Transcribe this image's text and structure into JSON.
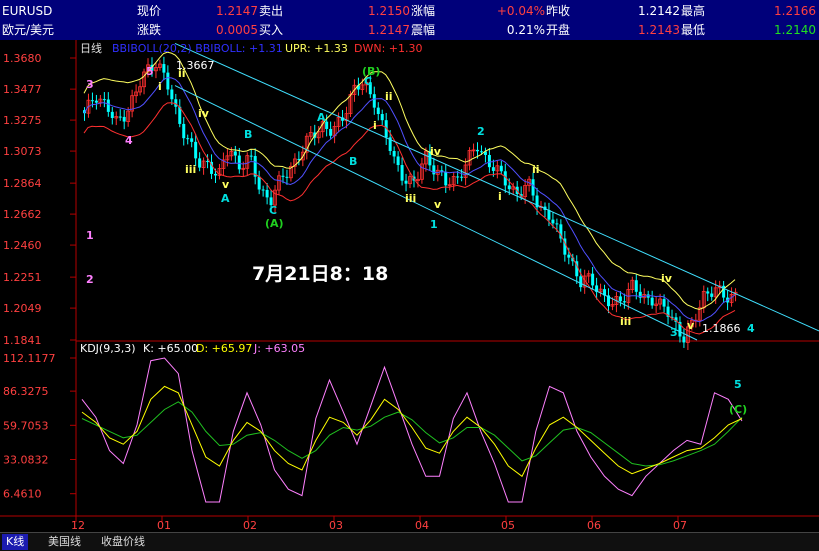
{
  "quote": {
    "symbol": "EURUSD",
    "name": "欧元/美元",
    "labels": {
      "last": "现价",
      "sell": "卖出",
      "change_pct": "涨幅",
      "prev_close": "昨收",
      "high": "最高",
      "change": "涨跌",
      "buy": "买入",
      "amplitude": "震幅",
      "open": "开盘",
      "low": "最低"
    },
    "values": {
      "last": "1.2147",
      "sell": "1.2150",
      "change_pct": "+0.04%",
      "prev_close": "1.2142",
      "high": "1.2166",
      "change": "0.0005",
      "buy": "1.2147",
      "amplitude": "0.21%",
      "open": "1.2143",
      "low": "1.2140"
    }
  },
  "colors": {
    "up": "#ff3030",
    "down": "#00ffff",
    "boll_mid": "#ffffff",
    "boll_up": "#ffff60",
    "boll_dn": "#ff3030",
    "k": "#ffffff",
    "d": "#ffff00",
    "j": "#ff80ff",
    "channel": "#40e0ff"
  },
  "main_panel": {
    "period": "日线",
    "indicator": "BBIBOLL(20,2)",
    "bbiboll_label": "BBIBOLL: +1.31",
    "upr_label": "UPR: +1.33",
    "dwn_label": "DWN: +1.30",
    "y_ticks": [
      "1.3680",
      "1.3477",
      "1.3275",
      "1.3073",
      "1.2864",
      "1.2662",
      "1.2460",
      "1.2251",
      "1.2049",
      "1.1841"
    ],
    "high_label": "1.3667",
    "low_label": "1.1866",
    "annotation": "7月21日8：18"
  },
  "kdj_panel": {
    "title": "KDJ(9,3,3)",
    "k_label": "K: +65.00",
    "d_label": "D: +65.97",
    "j_label": "J: +63.05",
    "y_ticks": [
      "112.1177",
      "86.3275",
      "59.7053",
      "33.0832",
      "6.4610"
    ]
  },
  "x_axis": {
    "ticks": [
      "12",
      "01",
      "02",
      "03",
      "04",
      "05",
      "06",
      "07"
    ]
  },
  "tabs": [
    "K线",
    "美国线",
    "收盘价线"
  ],
  "chart_data": {
    "type": "line",
    "x_ticks": [
      "12",
      "01",
      "02",
      "03",
      "04",
      "05",
      "06",
      "07"
    ],
    "price": {
      "ylim": [
        1.1841,
        1.368
      ],
      "close_path": [
        1.33,
        1.345,
        1.338,
        1.325,
        1.333,
        1.345,
        1.36,
        1.3667,
        1.35,
        1.33,
        1.315,
        1.298,
        1.3,
        1.29,
        1.31,
        1.298,
        1.302,
        1.283,
        1.275,
        1.288,
        1.298,
        1.306,
        1.318,
        1.325,
        1.318,
        1.33,
        1.348,
        1.35,
        1.342,
        1.32,
        1.3,
        1.29,
        1.285,
        1.305,
        1.295,
        1.285,
        1.29,
        1.3,
        1.31,
        1.302,
        1.293,
        1.285,
        1.28,
        1.284,
        1.272,
        1.265,
        1.25,
        1.238,
        1.22,
        1.225,
        1.215,
        1.205,
        1.212,
        1.22,
        1.21,
        1.212,
        1.205,
        1.196,
        1.1866,
        1.195,
        1.215,
        1.218,
        1.21,
        1.2147
      ],
      "channel_upper": {
        "start": 1.368,
        "end": 1.187
      },
      "channel_lower": {
        "start": 1.34,
        "end": 1.184
      },
      "wave_labels": [
        "3",
        "5",
        "i",
        "ii",
        "iii",
        "iv",
        "v",
        "4",
        "A",
        "B",
        "C",
        "(A)",
        "A",
        "B",
        "(B)",
        "C",
        "ii",
        "i",
        "iii",
        "iv",
        "v",
        "1",
        "2",
        "ii",
        "i",
        "iii",
        "iv",
        "v",
        "3",
        "4",
        "1",
        "2"
      ]
    },
    "kdj": {
      "ylim": [
        0,
        112.1177
      ],
      "k": [
        70,
        62,
        50,
        45,
        55,
        80,
        90,
        85,
        60,
        35,
        28,
        48,
        62,
        55,
        40,
        30,
        25,
        48,
        66,
        62,
        52,
        64,
        80,
        72,
        58,
        42,
        38,
        55,
        66,
        58,
        45,
        28,
        20,
        42,
        60,
        66,
        58,
        48,
        38,
        28,
        22,
        26,
        30,
        35,
        40,
        42,
        50,
        60,
        65
      ],
      "d": [
        65,
        60,
        55,
        50,
        52,
        62,
        72,
        78,
        70,
        55,
        44,
        45,
        52,
        54,
        48,
        40,
        34,
        40,
        52,
        58,
        56,
        59,
        66,
        70,
        64,
        54,
        46,
        50,
        58,
        58,
        52,
        42,
        32,
        36,
        46,
        56,
        58,
        54,
        46,
        38,
        30,
        28,
        29,
        32,
        36,
        40,
        45,
        55,
        65.97
      ],
      "j": [
        80,
        66,
        40,
        30,
        60,
        110,
        120,
        100,
        40,
        0,
        0,
        55,
        85,
        60,
        25,
        10,
        5,
        65,
        95,
        70,
        45,
        75,
        105,
        75,
        45,
        20,
        20,
        65,
        85,
        55,
        30,
        0,
        0,
        55,
        90,
        85,
        55,
        35,
        20,
        10,
        5,
        20,
        30,
        40,
        48,
        45,
        85,
        80,
        63.05
      ]
    },
    "series": [
      {
        "name": "BBIBOLL",
        "last": 1.31
      },
      {
        "name": "UPR",
        "last": 1.33
      },
      {
        "name": "DWN",
        "last": 1.3
      },
      {
        "name": "K",
        "last": 65.0
      },
      {
        "name": "D",
        "last": 65.97
      },
      {
        "name": "J",
        "last": 63.05
      }
    ]
  }
}
